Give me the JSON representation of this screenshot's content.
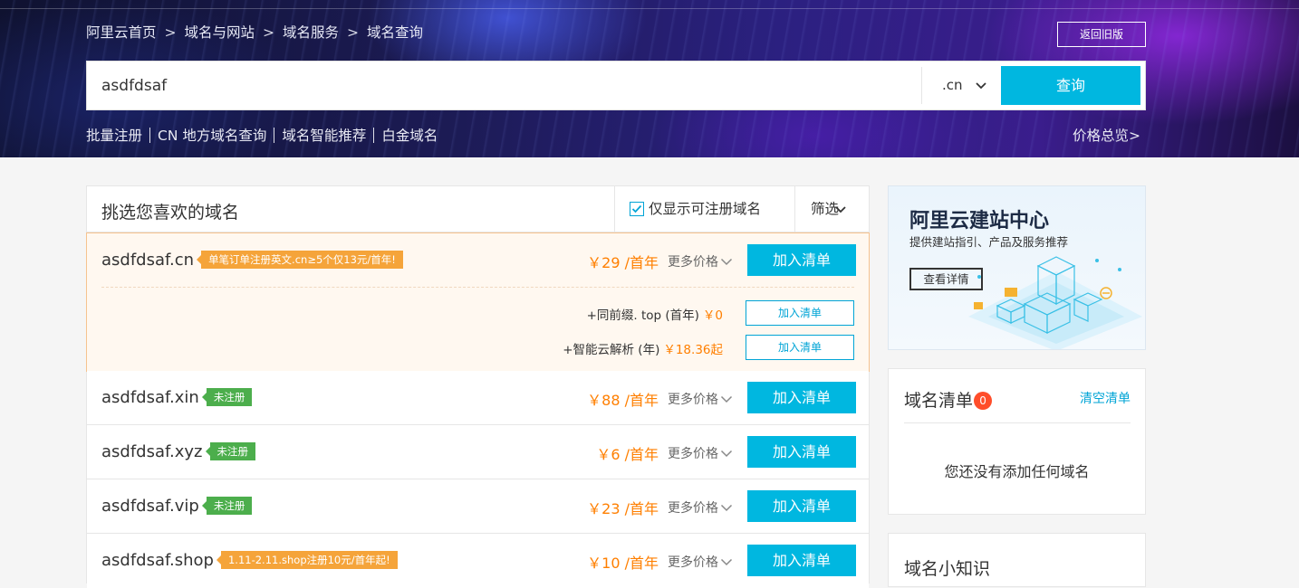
{
  "breadcrumb": {
    "items": [
      "阿里云首页",
      "域名与网站",
      "域名服务",
      "域名查询"
    ],
    "separator": ">"
  },
  "header": {
    "old_version_label": "返回旧版",
    "quick_links": [
      "批量注册",
      "CN 地方域名查询",
      "域名智能推荐",
      "白金域名"
    ],
    "price_overview_label": "价格总览>"
  },
  "search": {
    "value": "asdfdsaf",
    "tld": ".cn",
    "query_label": "查询"
  },
  "list": {
    "title": "挑选您喜欢的域名",
    "only_available_label": "仅显示可注册域名",
    "only_available_checked": true,
    "filter_label": "筛选",
    "more_price_label": "更多价格",
    "add_label": "加入清单",
    "rows": [
      {
        "domain": "asdfdsaf.cn",
        "tag": "单笔订单注册英文.cn≥5个仅13元/首年!",
        "tag_type": "orange",
        "price": "￥29 /首年"
      },
      {
        "domain": "asdfdsaf.xin",
        "tag": "未注册",
        "tag_type": "green",
        "price": "￥88 /首年"
      },
      {
        "domain": "asdfdsaf.xyz",
        "tag": "未注册",
        "tag_type": "green",
        "price": "￥6 /首年"
      },
      {
        "domain": "asdfdsaf.vip",
        "tag": "未注册",
        "tag_type": "green",
        "price": "￥23 /首年"
      },
      {
        "domain": "asdfdsaf.shop",
        "tag": "1.11-2.11.shop注册10元/首年起!",
        "tag_type": "orange",
        "price": "￥10 /首年"
      }
    ],
    "addons": [
      {
        "label": "+同前缀. top (首年)",
        "amount": "￥0",
        "button": "加入清单"
      },
      {
        "label": "+智能云解析 (年)",
        "amount": "￥18.36起",
        "button": "加入清单"
      }
    ]
  },
  "promo": {
    "title": "阿里云建站中心",
    "subtitle": "提供建站指引、产品及服务推荐",
    "button": "查看详情"
  },
  "cart": {
    "title": "域名清单",
    "count": "0",
    "clear_label": "清空清单",
    "empty_text": "您还没有添加任何域名"
  },
  "tips": {
    "title": "域名小知识"
  },
  "colors": {
    "accent": "#00b7e0",
    "price": "#ff7f00",
    "tag_orange": "#f5a43a",
    "tag_green": "#4cae4c",
    "badge": "#ff4d2a"
  }
}
